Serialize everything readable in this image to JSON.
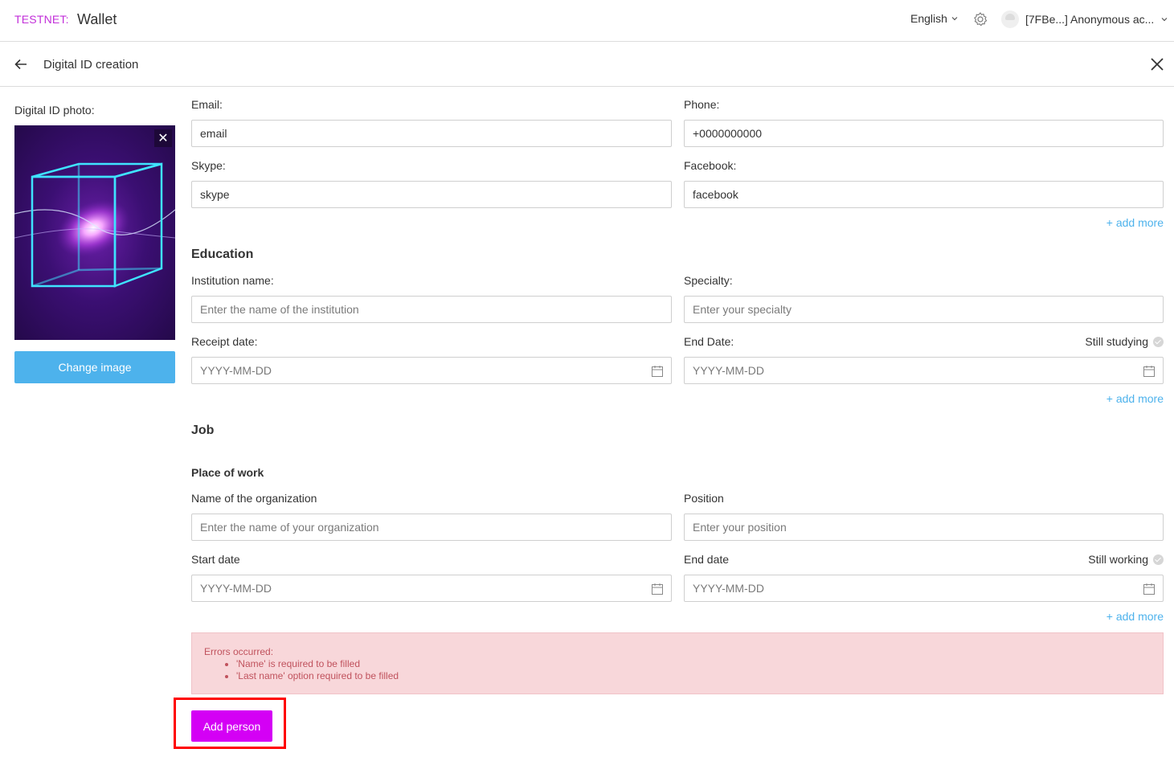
{
  "header": {
    "network": "TESTNET:",
    "app_title": "Wallet",
    "language": "English",
    "account": "[7FBe...] Anonymous ac...",
    "icons": [
      "gear-icon",
      "avatar",
      "chevron-down-icon"
    ]
  },
  "subheader": {
    "title": "Digital ID creation"
  },
  "photo": {
    "label": "Digital ID photo:",
    "remove_label": "✕",
    "change_button": "Change image"
  },
  "contacts": {
    "email_label": "Email:",
    "email_value": "email",
    "phone_label": "Phone:",
    "phone_value": "+0000000000",
    "skype_label": "Skype:",
    "skype_value": "skype",
    "facebook_label": "Facebook:",
    "facebook_value": "facebook",
    "add_more": "+ add more"
  },
  "education": {
    "title": "Education",
    "institution_label": "Institution name:",
    "institution_placeholder": "Enter the name of the institution",
    "specialty_label": "Specialty:",
    "specialty_placeholder": "Enter your specialty",
    "receipt_label": "Receipt date:",
    "receipt_placeholder": "YYYY-MM-DD",
    "end_label": "End Date:",
    "end_placeholder": "YYYY-MM-DD",
    "still_label": "Still studying",
    "add_more": "+ add more"
  },
  "job": {
    "title": "Job",
    "place_title": "Place of work",
    "org_label": "Name of the organization",
    "org_placeholder": "Enter the name of your organization",
    "position_label": "Position",
    "position_placeholder": "Enter your position",
    "start_label": "Start date",
    "start_placeholder": "YYYY-MM-DD",
    "end_label": "End date",
    "end_placeholder": "YYYY-MM-DD",
    "still_label": "Still working",
    "add_more": "+ add more"
  },
  "errors": {
    "title": "Errors occurred:",
    "items": [
      "'Name' is required to be filled",
      "'Last name' option required to be filled"
    ]
  },
  "submit": {
    "label": "Add person"
  },
  "colors": {
    "network": "#c22fd9",
    "accent_blue": "#4db2ec",
    "submit": "#d400f5",
    "error_bg": "#f8d7da",
    "error_text": "#c0525d",
    "highlight": "#ff0000"
  }
}
